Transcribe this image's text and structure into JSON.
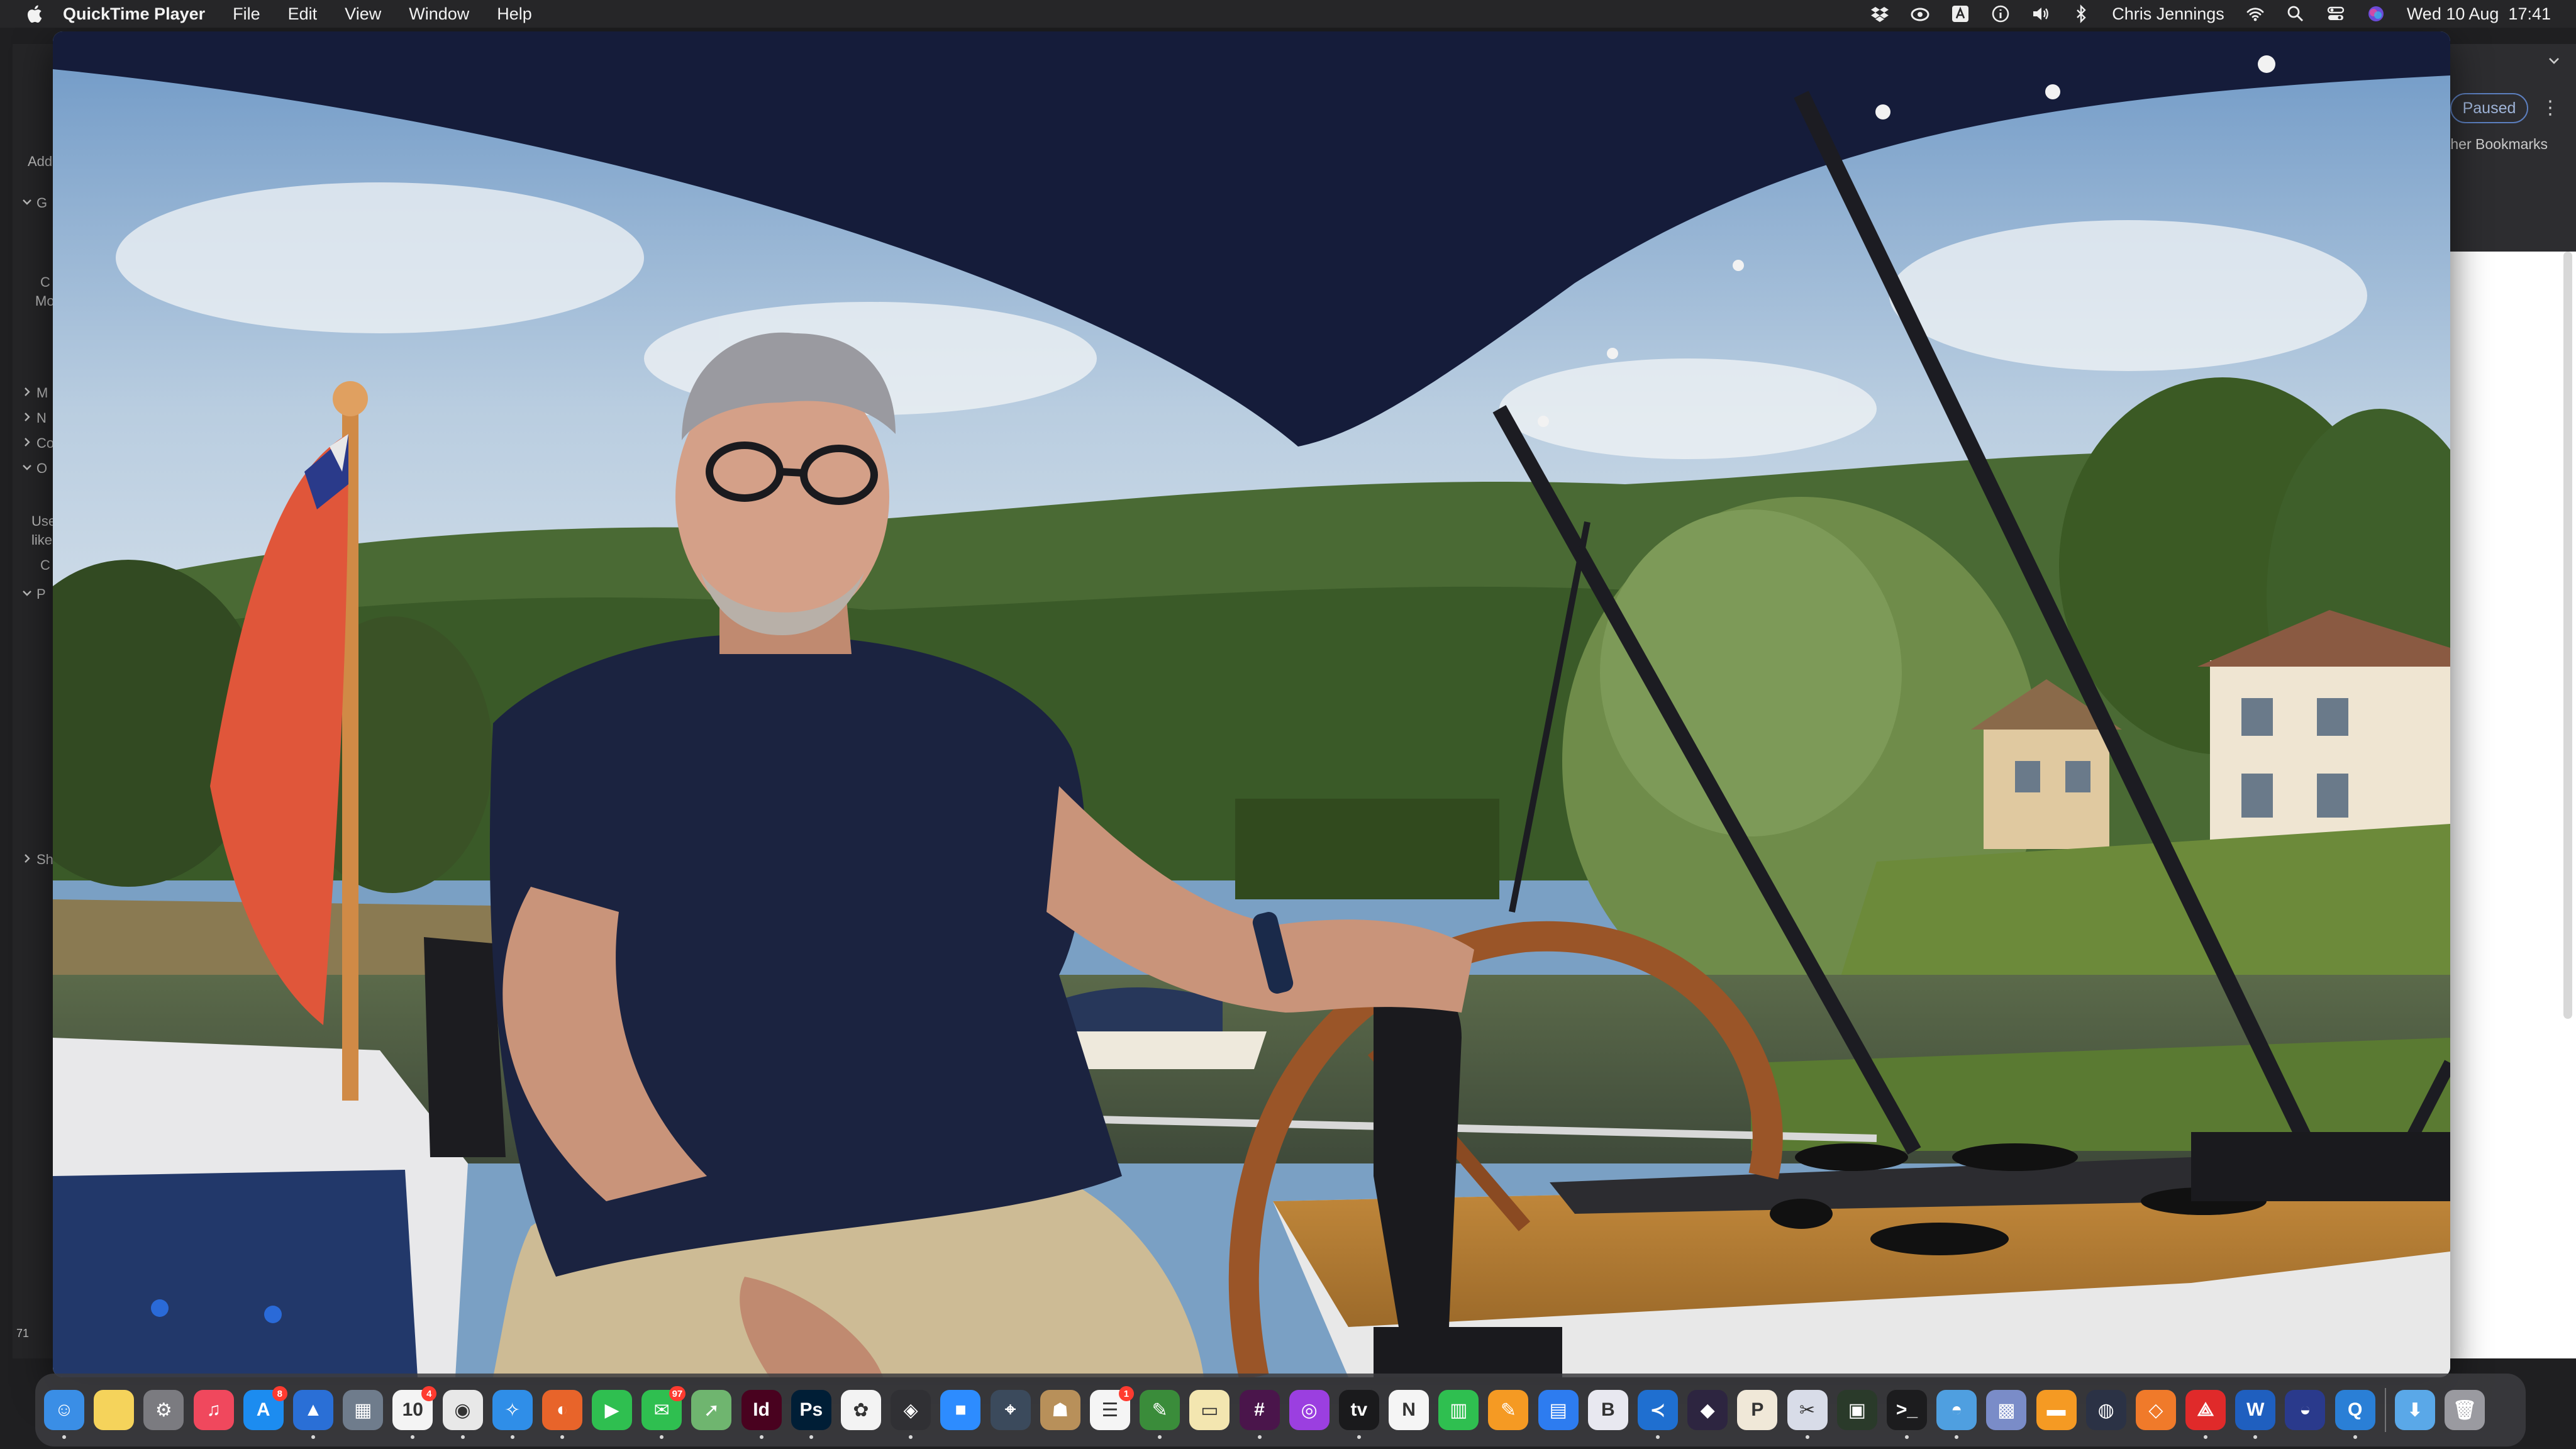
{
  "menubar": {
    "app_name": "QuickTime Player",
    "menus": [
      "File",
      "Edit",
      "View",
      "Window",
      "Help"
    ],
    "user_name": "Chris Jennings",
    "clock": "Wed 10 Aug  17:41",
    "status_icons": [
      "dropbox-icon",
      "creative-cloud-icon",
      "text-input-icon",
      "info-icon",
      "volume-icon",
      "bluetooth-icon",
      "wifi-icon",
      "spotlight-search-icon",
      "control-center-icon",
      "siri-icon"
    ]
  },
  "background_window": {
    "paused_label": "Paused",
    "bookmarks_label": "ther Bookmarks",
    "sidebar_fragments": [
      "Add",
      "G",
      "C",
      "Mo",
      "M",
      "N",
      "Co",
      "O",
      "Use",
      "like",
      "C",
      "P",
      "Sh",
      "71"
    ]
  },
  "video": {
    "content": "man-steering-boat-on-river",
    "flag": "red-ensign",
    "sky_color": "#8fb3d6",
    "canopy_color": "#151c3a",
    "shirt_color": "#1b2340",
    "wheel_color": "#9a5528"
  },
  "dock": {
    "apps": [
      {
        "name": "Finder",
        "icon": "finder-icon",
        "glyph": "☺",
        "color": "#3a8ee6"
      },
      {
        "name": "Notes",
        "icon": "notes-icon",
        "glyph": "",
        "color": "#f5d35b"
      },
      {
        "name": "System Preferences",
        "icon": "system-preferences-icon",
        "glyph": "⚙",
        "color": "#7b7b80"
      },
      {
        "name": "Music",
        "icon": "music-icon",
        "glyph": "♫",
        "color": "#f0485d"
      },
      {
        "name": "App Store",
        "icon": "app-store-icon",
        "glyph": "A",
        "color": "#1c8cf0",
        "badge": "8"
      },
      {
        "name": "Instruments",
        "icon": "instruments-icon",
        "glyph": "▲",
        "color": "#2a6fd6"
      },
      {
        "name": "Launchpad",
        "icon": "launchpad-icon",
        "glyph": "▦",
        "color": "#6f7c8c"
      },
      {
        "name": "Calendar",
        "icon": "calendar-icon",
        "glyph": "10",
        "color": "#f4f4f4",
        "badge": "4"
      },
      {
        "name": "Chrome",
        "icon": "chrome-icon",
        "glyph": "◉",
        "color": "#e8e8e8"
      },
      {
        "name": "Safari",
        "icon": "safari-icon",
        "glyph": "✧",
        "color": "#2f8ee8"
      },
      {
        "name": "Firefox",
        "icon": "firefox-icon",
        "glyph": "◐",
        "color": "#e8642a"
      },
      {
        "name": "FaceTime",
        "icon": "facetime-icon",
        "glyph": "▶",
        "color": "#2fbf50"
      },
      {
        "name": "Messages",
        "icon": "messages-icon",
        "glyph": "✉",
        "color": "#2fbf50",
        "badge": "97"
      },
      {
        "name": "Maps",
        "icon": "maps-icon",
        "glyph": "➚",
        "color": "#6fb56f"
      },
      {
        "name": "InDesign",
        "icon": "indesign-icon",
        "glyph": "Id",
        "color": "#49021f"
      },
      {
        "name": "Photoshop",
        "icon": "photoshop-icon",
        "glyph": "Ps",
        "color": "#001e36"
      },
      {
        "name": "Photos",
        "icon": "photos-icon",
        "glyph": "✿",
        "color": "#f3f3f3"
      },
      {
        "name": "DaVinci Resolve",
        "icon": "davinci-resolve-icon",
        "glyph": "◈",
        "color": "#303034"
      },
      {
        "name": "Zoom",
        "icon": "zoom-icon",
        "glyph": "■",
        "color": "#2d8cff"
      },
      {
        "name": "Location",
        "icon": "location-icon",
        "glyph": "⌖",
        "color": "#3b4a5c"
      },
      {
        "name": "Contacts",
        "icon": "contacts-icon",
        "glyph": "☗",
        "color": "#b8905a"
      },
      {
        "name": "Reminders",
        "icon": "reminders-icon",
        "glyph": "☰",
        "color": "#f5f5f5",
        "badge": "1"
      },
      {
        "name": "Script Editor",
        "icon": "script-editor-icon",
        "glyph": "✎",
        "color": "#3a8c3a"
      },
      {
        "name": "Files",
        "icon": "files-icon",
        "glyph": "▭",
        "color": "#f3e6b0"
      },
      {
        "name": "Slack",
        "icon": "slack-icon",
        "glyph": "#",
        "color": "#4a154b"
      },
      {
        "name": "Podcasts",
        "icon": "podcasts-icon",
        "glyph": "◎",
        "color": "#9b3fe0"
      },
      {
        "name": "TV",
        "icon": "tv-icon",
        "glyph": "tv",
        "color": "#1a1a1c"
      },
      {
        "name": "News",
        "icon": "news-icon",
        "glyph": "N",
        "color": "#f5f5f5"
      },
      {
        "name": "Numbers",
        "icon": "numbers-icon",
        "glyph": "▥",
        "color": "#2fbf50"
      },
      {
        "name": "Pages",
        "icon": "pages-icon",
        "glyph": "✎",
        "color": "#f59a23"
      },
      {
        "name": "Keynote",
        "icon": "keynote-icon",
        "glyph": "▤",
        "color": "#2d7cf0"
      },
      {
        "name": "BBEdit",
        "icon": "bbedit-icon",
        "glyph": "B",
        "color": "#e8e8f0"
      },
      {
        "name": "VS Code",
        "icon": "vscode-icon",
        "glyph": "≺",
        "color": "#1f6fd0"
      },
      {
        "name": "Obsidian",
        "icon": "obsidian-icon",
        "glyph": "◆",
        "color": "#2d2540"
      },
      {
        "name": "Plex",
        "icon": "plex-icon",
        "glyph": "P",
        "color": "#f0e8d8"
      },
      {
        "name": "Preview",
        "icon": "preview-icon",
        "glyph": "✂",
        "color": "#d8dce8"
      },
      {
        "name": "Activity Monitor",
        "icon": "activity-monitor-icon",
        "glyph": "▣",
        "color": "#2a3a2a"
      },
      {
        "name": "Terminal",
        "icon": "terminal-icon",
        "glyph": ">_",
        "color": "#1c1c1e"
      },
      {
        "name": "Weather",
        "icon": "weather-icon",
        "glyph": "◓",
        "color": "#4f9fe0"
      },
      {
        "name": "Archive Utility",
        "icon": "archive-utility-icon",
        "glyph": "▩",
        "color": "#7a8cc8"
      },
      {
        "name": "Books",
        "icon": "books-icon",
        "glyph": "▬",
        "color": "#f59a23"
      },
      {
        "name": "Disk Utility",
        "icon": "disk-utility-icon",
        "glyph": "◍",
        "color": "#2b3245"
      },
      {
        "name": "Transmit",
        "icon": "transmit-icon",
        "glyph": "◇",
        "color": "#f07a2a"
      },
      {
        "name": "Acrobat",
        "icon": "acrobat-icon",
        "glyph": "⟁",
        "color": "#e02a2a"
      },
      {
        "name": "Word",
        "icon": "word-icon",
        "glyph": "W",
        "color": "#1f5fbf"
      },
      {
        "name": "Tunnelblick",
        "icon": "tunnelblick-icon",
        "glyph": "◒",
        "color": "#2a3a8c"
      },
      {
        "name": "QuickTime Player",
        "icon": "quicktime-icon",
        "glyph": "Q",
        "color": "#2a7fd6"
      }
    ],
    "trailing": [
      {
        "name": "Downloads",
        "icon": "downloads-folder-icon",
        "glyph": "⬇",
        "color": "#5aa8e8"
      },
      {
        "name": "Trash",
        "icon": "trash-icon",
        "glyph": "🗑",
        "color": "#9a9aa0"
      }
    ]
  }
}
